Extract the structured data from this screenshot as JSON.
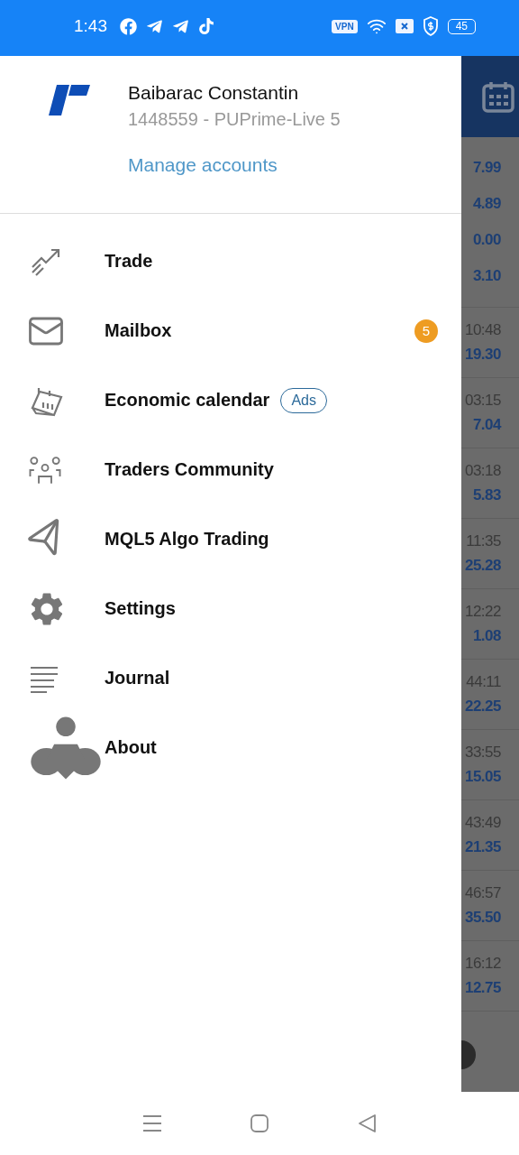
{
  "status_bar": {
    "time": "1:43",
    "vpn": "VPN",
    "battery": "45"
  },
  "account": {
    "name": "Baibarac Constantin",
    "login": "1448559 - PUPrime-Live 5",
    "manage": "Manage accounts"
  },
  "menu": [
    {
      "label": "Trade"
    },
    {
      "label": "Mailbox",
      "badge": "5"
    },
    {
      "label": "Economic calendar",
      "tag": "Ads"
    },
    {
      "label": "Traders Community"
    },
    {
      "label": "MQL5 Algo Trading"
    },
    {
      "label": "Settings"
    },
    {
      "label": "Journal"
    },
    {
      "label": "About"
    }
  ],
  "background": {
    "prices": [
      "7.99",
      "4.89",
      "0.00",
      "3.10"
    ],
    "rows": [
      {
        "time": "10:48",
        "value": "19.30"
      },
      {
        "time": "03:15",
        "value": "7.04"
      },
      {
        "time": "03:18",
        "value": "5.83"
      },
      {
        "time": "11:35",
        "value": "25.28"
      },
      {
        "time": "12:22",
        "value": "1.08"
      },
      {
        "time": "44:11",
        "value": "22.25"
      },
      {
        "time": "33:55",
        "value": "15.05"
      },
      {
        "time": "43:49",
        "value": "21.35"
      },
      {
        "time": "46:57",
        "value": "35.50"
      },
      {
        "time": "16:12",
        "value": "12.75"
      }
    ]
  }
}
